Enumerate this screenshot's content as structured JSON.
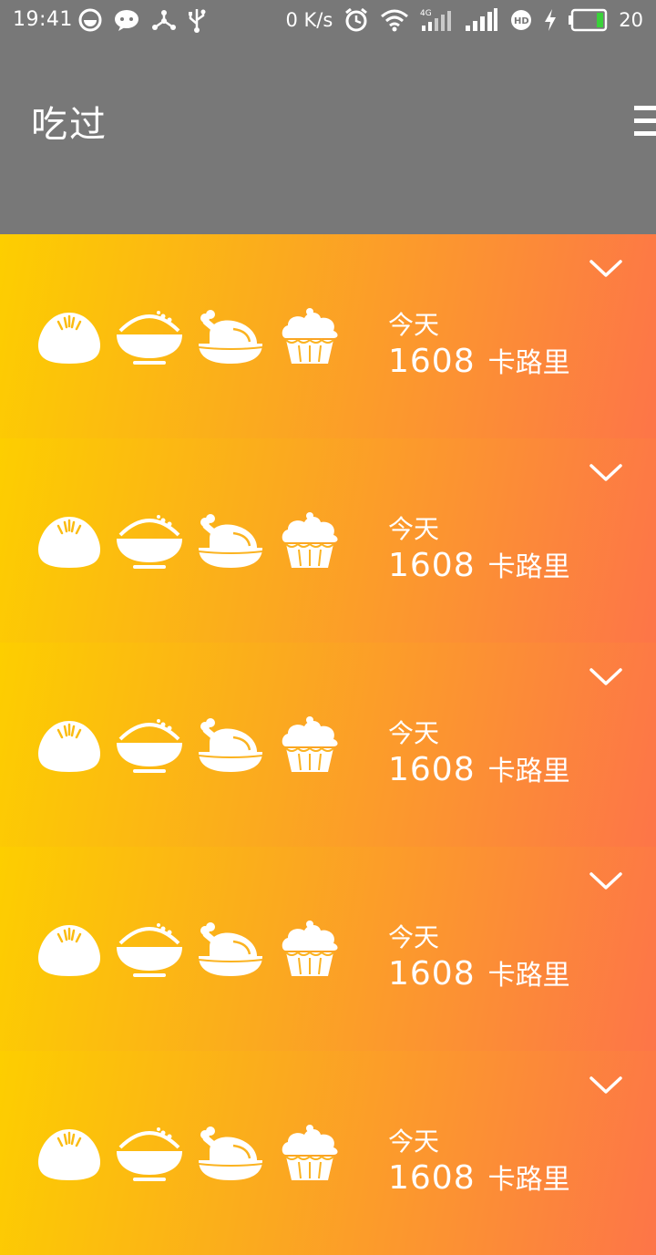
{
  "status_bar": {
    "time": "19:41",
    "net_speed": "0 K/s",
    "network_type": "4G",
    "battery_level": "20",
    "icons": [
      "circle-app-icon",
      "wechat-icon",
      "share-icon",
      "usb-icon",
      "alarm-icon",
      "wifi-icon",
      "signal-4g-icon",
      "signal-icon",
      "hd-icon",
      "charging-icon",
      "battery-icon"
    ]
  },
  "app_bar": {
    "title": "吃过",
    "menu_icon": "hamburger-menu-icon"
  },
  "meals": [
    {
      "day": "今天",
      "calories": "1608",
      "unit": "卡路里",
      "icons": [
        "bun-icon",
        "rice-bowl-icon",
        "roast-chicken-icon",
        "cupcake-icon"
      ],
      "expand_icon": "chevron-down-icon"
    },
    {
      "day": "今天",
      "calories": "1608",
      "unit": "卡路里",
      "icons": [
        "bun-icon",
        "rice-bowl-icon",
        "roast-chicken-icon",
        "cupcake-icon"
      ],
      "expand_icon": "chevron-down-icon"
    },
    {
      "day": "今天",
      "calories": "1608",
      "unit": "卡路里",
      "icons": [
        "bun-icon",
        "rice-bowl-icon",
        "roast-chicken-icon",
        "cupcake-icon"
      ],
      "expand_icon": "chevron-down-icon"
    },
    {
      "day": "今天",
      "calories": "1608",
      "unit": "卡路里",
      "icons": [
        "bun-icon",
        "rice-bowl-icon",
        "roast-chicken-icon",
        "cupcake-icon"
      ],
      "expand_icon": "chevron-down-icon"
    },
    {
      "day": "今天",
      "calories": "1608",
      "unit": "卡路里",
      "icons": [
        "bun-icon",
        "rice-bowl-icon",
        "roast-chicken-icon",
        "cupcake-icon"
      ],
      "expand_icon": "chevron-down-icon"
    }
  ],
  "colors": {
    "app_bar": "#787878",
    "gradient_start": "#fdce00",
    "gradient_end": "#fd7548",
    "text": "#ffffff"
  }
}
